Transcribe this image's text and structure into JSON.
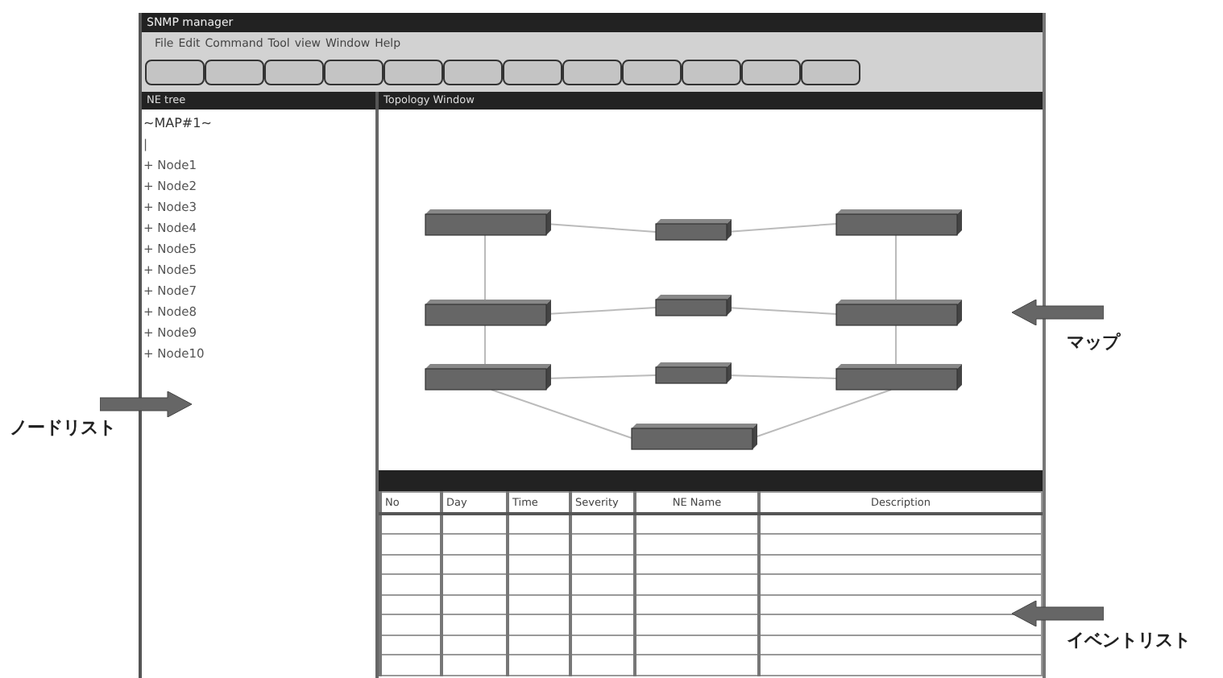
{
  "window": {
    "title": "SNMP manager"
  },
  "menu": [
    "File",
    "Edit",
    "Command",
    "Tool",
    "view",
    "Window",
    "Help"
  ],
  "ne_tree": {
    "title": "NE tree",
    "root": "~MAP#1~",
    "connector": "|",
    "items": [
      {
        "expander": "+",
        "label": "Node1"
      },
      {
        "expander": "+",
        "label": "Node2"
      },
      {
        "expander": "+",
        "label": "Node3"
      },
      {
        "expander": "+",
        "label": "Node4"
      },
      {
        "expander": "+",
        "label": "Node5"
      },
      {
        "expander": "+",
        "label": "Node5"
      },
      {
        "expander": "+",
        "label": "Node7"
      },
      {
        "expander": "+",
        "label": "Node8"
      },
      {
        "expander": "+",
        "label": "Node9"
      },
      {
        "expander": "+",
        "label": "Node10"
      }
    ]
  },
  "topology": {
    "title": "Topology Window"
  },
  "event_table": {
    "columns": [
      "No",
      "Day",
      "Time",
      "Severity",
      "NE Name",
      "Description"
    ]
  },
  "annotations": [
    {
      "label": "ノードリスト",
      "kind": "rightarrow"
    },
    {
      "label": "マップ",
      "kind": "leftarrow"
    },
    {
      "label": "イベントリスト",
      "kind": "leftarrow"
    }
  ]
}
